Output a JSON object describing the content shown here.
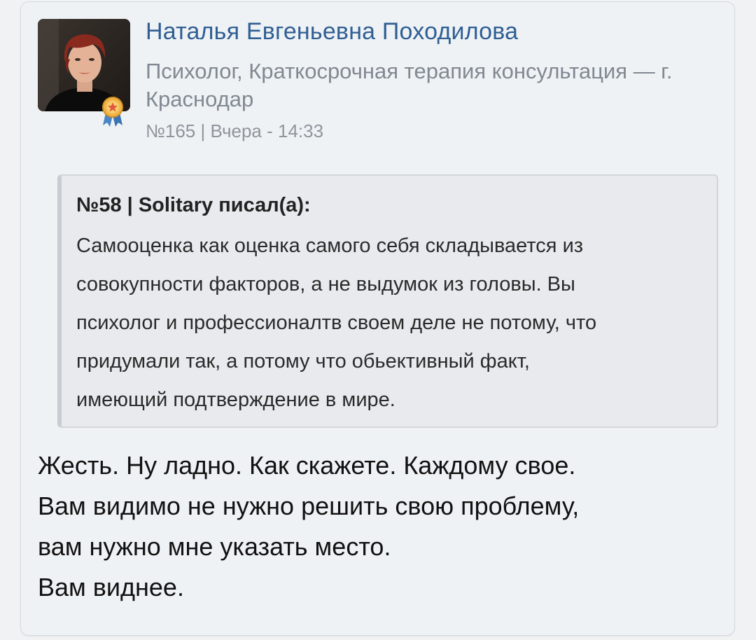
{
  "author": {
    "name": "Наталья Евгеньевна Походилова",
    "role": "Психолог, Краткосрочная терапия консультация — г. Краснодар",
    "avatar_icon": "user-avatar-photo",
    "badge_icon": "award-medal-icon"
  },
  "post": {
    "meta": "№165 | Вчера - 14:33",
    "body_lines": [
      "Жесть. Ну ладно. Как скажете. Каждому свое.",
      "Вам видимо не нужно решить свою проблему,",
      "вам нужно мне указать место.",
      "Вам виднее."
    ]
  },
  "quote": {
    "header": "№58 | Solitary писал(а):",
    "lines": [
      "Самооценка как оценка самого себя складывается из",
      "совокупности факторов, а не выдумок из головы. Вы",
      "психолог и профессионалтв своем деле не потому, что",
      "придумали так, а потому что обьективный факт,",
      "имеющий подтверждение в мире."
    ]
  },
  "colors": {
    "author_link": "#2f5f93",
    "muted_text": "#808891",
    "quote_background": "#e8eaed",
    "badge_gold": "#e8a33a",
    "badge_ribbon": "#4a86c5"
  }
}
